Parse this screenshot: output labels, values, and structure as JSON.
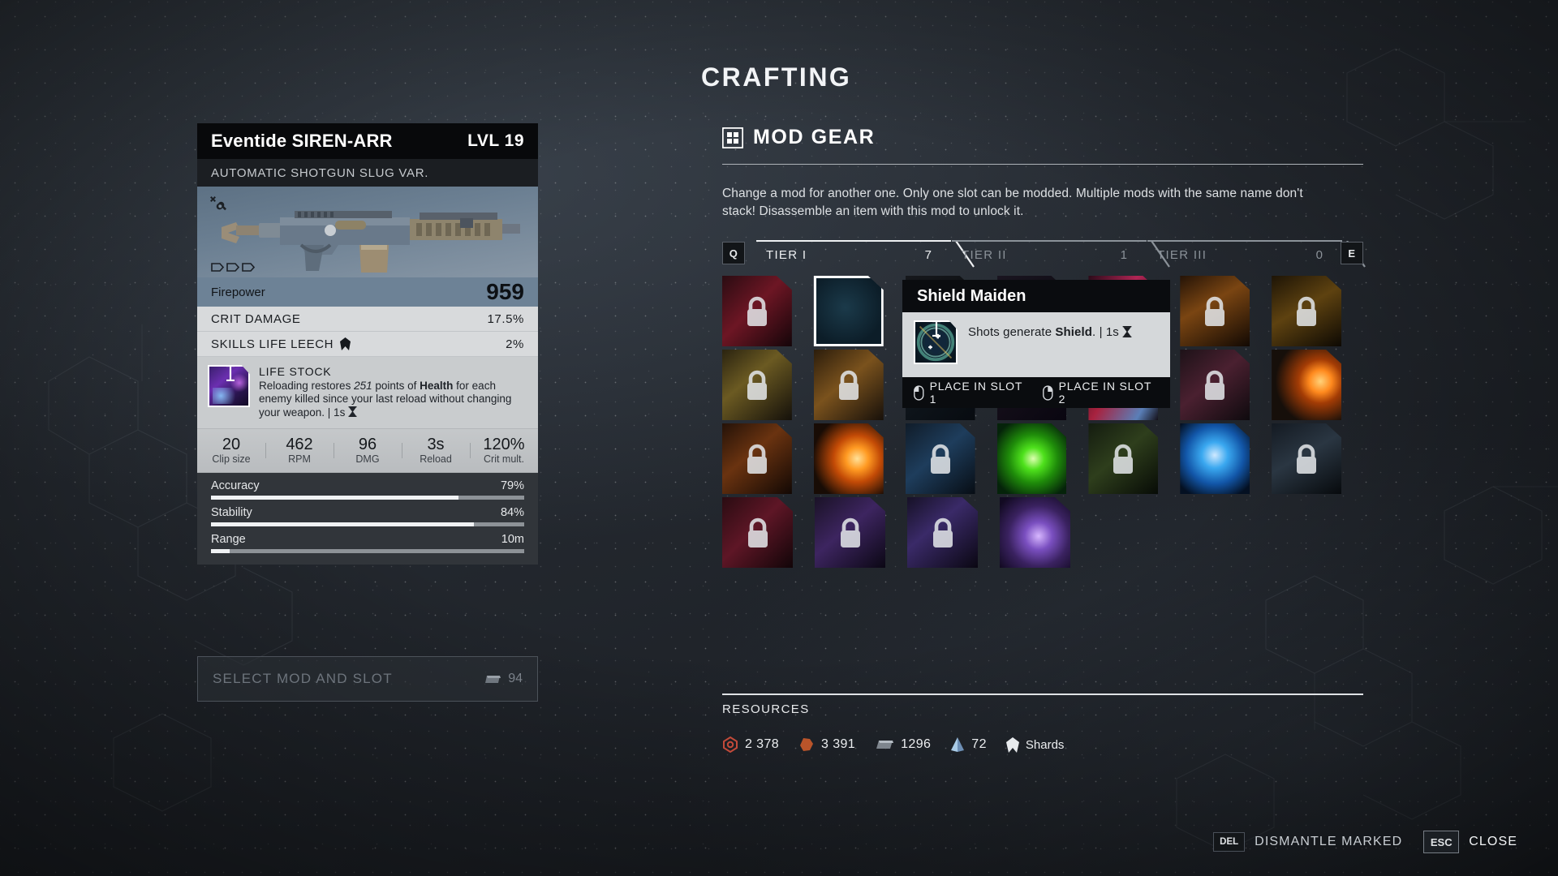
{
  "weapon": {
    "name": "Eventide SIREN-ARR",
    "level_label": "LVL 19",
    "subtitle": "AUTOMATIC SHOTGUN SLUG VAR.",
    "firepower_label": "Firepower",
    "firepower_value": "959",
    "stats": [
      {
        "label": "CRIT DAMAGE",
        "value": "17.5%",
        "has_shard_icon": false
      },
      {
        "label": "SKILLS LIFE LEECH",
        "value": "2%",
        "has_shard_icon": true
      }
    ],
    "mod": {
      "title": "LIFE STOCK",
      "desc_parts": [
        {
          "t": "Reloading restores ",
          "s": "normal"
        },
        {
          "t": "251",
          "s": "italic"
        },
        {
          "t": " points of ",
          "s": "normal"
        },
        {
          "t": "Health",
          "s": "bold"
        },
        {
          "t": " for each enemy killed since your last reload without changing your weapon. | 1s ",
          "s": "normal"
        }
      ],
      "duration": "1s"
    },
    "numbers": [
      {
        "value": "20",
        "label": "Clip size"
      },
      {
        "value": "462",
        "label": "RPM"
      },
      {
        "value": "96",
        "label": "DMG"
      },
      {
        "value": "3s",
        "label": "Reload"
      },
      {
        "value": "120%",
        "label": "Crit mult."
      }
    ],
    "bars": [
      {
        "label": "Accuracy",
        "value": "79%",
        "pct": 79
      },
      {
        "label": "Stability",
        "value": "84%",
        "pct": 84
      },
      {
        "label": "Range",
        "value": "10m",
        "pct": 6
      }
    ],
    "ammo_pips": 3
  },
  "select_bar": {
    "label": "SELECT MOD AND SLOT",
    "material_count": "94",
    "material_icon": "ingot-icon"
  },
  "panel": {
    "title": "CRAFTING",
    "section_title": "MOD GEAR",
    "section_icon": "grid-icon",
    "description": "Change a mod for another one. Only one slot can be modded. Multiple mods with the same name don't stack! Disassemble an item with this mod to unlock it."
  },
  "tiers": {
    "prev_key": "Q",
    "next_key": "E",
    "tabs": [
      {
        "name": "TIER I",
        "count": "7",
        "active": true
      },
      {
        "name": "TIER II",
        "count": "1",
        "active": false
      },
      {
        "name": "TIER III",
        "count": "0",
        "active": false
      }
    ]
  },
  "tooltip": {
    "title": "Shield Maiden",
    "desc_prefix": "Shots generate ",
    "desc_bold": "Shield",
    "desc_suffix": ". | 1s ",
    "actions": [
      {
        "icon": "mouse-left-icon",
        "label": "PLACE IN SLOT 1"
      },
      {
        "icon": "mouse-right-icon",
        "label": "PLACE IN SLOT 2"
      }
    ]
  },
  "mod_grid": {
    "columns": 7,
    "cells": [
      {
        "locked": true,
        "art": "crimson-wing",
        "sel": false
      },
      {
        "locked": false,
        "art": "shield-maiden",
        "sel": true
      },
      {
        "locked": true,
        "art": "dark-slot",
        "sel": false
      },
      {
        "locked": true,
        "art": "dark-slot2",
        "sel": false
      },
      {
        "locked": true,
        "art": "magenta-flash",
        "sel": false
      },
      {
        "locked": true,
        "art": "amber-corridor",
        "sel": false
      },
      {
        "locked": true,
        "art": "amber-arrows",
        "sel": false
      },
      {
        "locked": true,
        "art": "dusty-gold",
        "sel": false
      },
      {
        "locked": true,
        "art": "warm-brown",
        "sel": false
      },
      {
        "locked": true,
        "art": "dark-slot3",
        "sel": false
      },
      {
        "locked": true,
        "art": "dark-slot4",
        "sel": false
      },
      {
        "locked": true,
        "art": "crimson-ice",
        "sel": false
      },
      {
        "locked": true,
        "art": "crowd-dark",
        "sel": false
      },
      {
        "locked": false,
        "art": "fire-comet",
        "sel": false
      },
      {
        "locked": true,
        "art": "ember-dark",
        "sel": false
      },
      {
        "locked": false,
        "art": "fire-blast",
        "sel": false
      },
      {
        "locked": true,
        "art": "blue-steel",
        "sel": false
      },
      {
        "locked": false,
        "art": "green-burst",
        "sel": false
      },
      {
        "locked": true,
        "art": "olive-dark",
        "sel": false
      },
      {
        "locked": false,
        "art": "blue-dome",
        "sel": false
      },
      {
        "locked": true,
        "art": "night-slope",
        "sel": false
      },
      {
        "locked": true,
        "art": "red-haze",
        "sel": false
      },
      {
        "locked": true,
        "art": "violet-crowd",
        "sel": false
      },
      {
        "locked": true,
        "art": "purple-beam",
        "sel": false
      },
      {
        "locked": false,
        "art": "hero-blade",
        "sel": false
      }
    ]
  },
  "resources": {
    "title": "RESOURCES",
    "items": [
      {
        "icon": "scrap-icon",
        "value": "2 378"
      },
      {
        "icon": "leather-icon",
        "value": "3 391"
      },
      {
        "icon": "ingot-icon",
        "value": "1296"
      },
      {
        "icon": "crystal-icon",
        "value": "72"
      },
      {
        "icon": "shard-icon",
        "value": "Shards"
      }
    ]
  },
  "footer": {
    "actions": [
      {
        "key": "DEL",
        "label": "DISMANTLE MARKED",
        "big": false
      },
      {
        "key": "ESC",
        "label": "CLOSE",
        "big": true
      }
    ]
  },
  "colors": {
    "accent_blue": "#6d8296",
    "panel_light": "#d8dadc",
    "dark": "#08090b"
  }
}
